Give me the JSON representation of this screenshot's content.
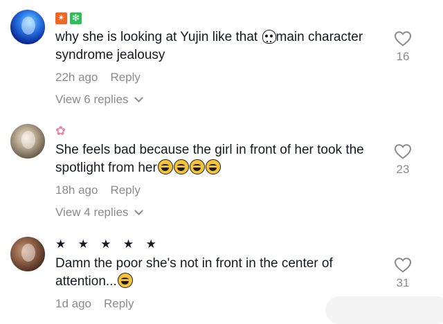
{
  "comments": [
    {
      "text_before": "why she is looking at Yujin like that ",
      "emoji_mid": "skull",
      "text_after": "main character syndrome jealousy",
      "time": "22h ago",
      "reply": "Reply",
      "view_replies": "View 6 replies",
      "likes": "16",
      "badges": [
        "✴",
        "❇"
      ]
    },
    {
      "decoration": "✿",
      "text_before": "She feels bad because the girl in front of her took the spotlight from her",
      "emoji_trailing": [
        "laugh",
        "laugh",
        "laugh",
        "laugh"
      ],
      "time": "18h ago",
      "reply": "Reply",
      "view_replies": "View 4 replies",
      "likes": "23"
    },
    {
      "decoration": "★ ★ ★ ★ ★",
      "text_before": "Damn the poor she's not in front in the center of attention...",
      "emoji_trailing": [
        "rofl"
      ],
      "time": "1d ago",
      "reply": "Reply",
      "likes": "31"
    }
  ],
  "icons": {
    "like": "heart-outline-icon",
    "expand": "chevron-down-icon"
  },
  "colors": {
    "text": "#161823",
    "secondary": "#8a8b91"
  }
}
